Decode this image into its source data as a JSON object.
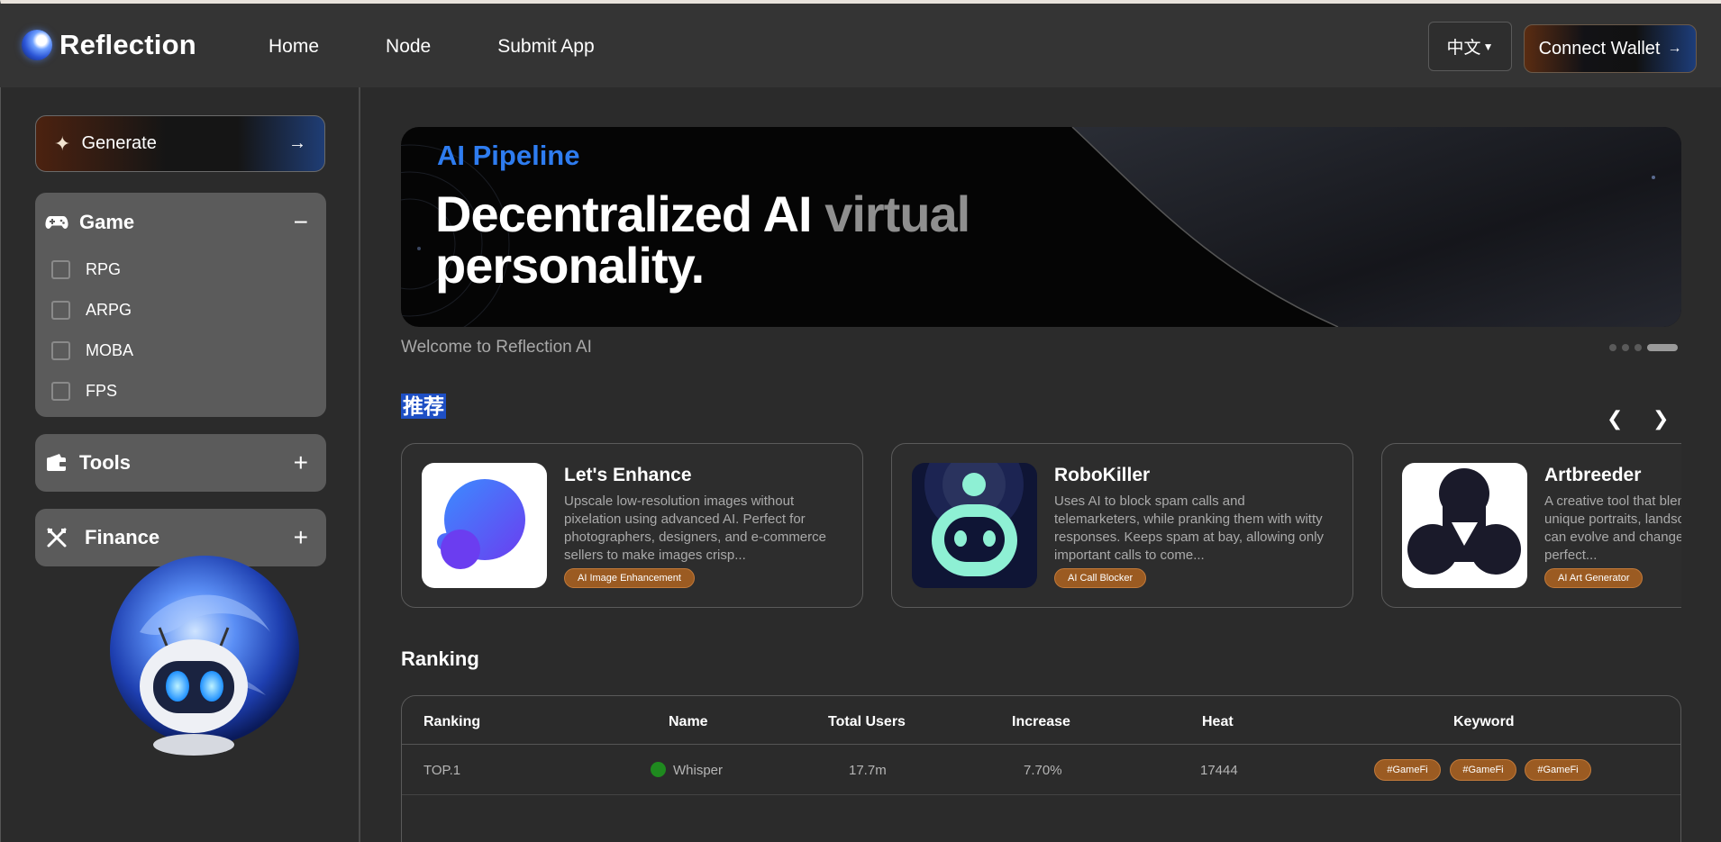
{
  "app": {
    "name": "Reflection"
  },
  "nav": {
    "items": [
      "Home",
      "Node",
      "Submit App"
    ],
    "language": "中文",
    "connect_wallet": "Connect Wallet"
  },
  "sidebar": {
    "generate_label": "Generate",
    "categories": [
      {
        "title": "Game",
        "expanded": true,
        "toggle": "−",
        "options": [
          "RPG",
          "ARPG",
          "MOBA",
          "FPS"
        ]
      },
      {
        "title": "Tools",
        "expanded": false,
        "toggle": "+"
      },
      {
        "title": "Finance",
        "expanded": false,
        "toggle": "+"
      }
    ]
  },
  "banner": {
    "eyebrow": "AI Pipeline",
    "title_part1": "Decentralized AI ",
    "title_part2": "virtual",
    "title_line2": "personality.",
    "caption": "Welcome to Reflection AI",
    "slides_total": 4,
    "active_slide": 4
  },
  "recommended": {
    "title": "推荐",
    "cards": [
      {
        "name": "Let's Enhance",
        "description": "Upscale low-resolution images without pixelation using advanced AI. Perfect for photographers, designers, and e-commerce sellers to make images crisp...",
        "tag": "AI Image Enhancement"
      },
      {
        "name": "RoboKiller",
        "description": "Uses AI to block spam calls and telemarketers, while pranking them with witty responses. Keeps spam at bay, allowing only important calls to come...",
        "tag": "AI Call Blocker"
      },
      {
        "name": "Artbreeder",
        "description": "A creative tool that blends images to create unique portraits, landscapes, and more. You can evolve and change visuals using AI, perfect...",
        "tag": "AI Art Generator"
      }
    ]
  },
  "ranking": {
    "title": "Ranking",
    "headers": [
      "Ranking",
      "Name",
      "Total Users",
      "Increase",
      "Heat",
      "Keyword"
    ],
    "rows": [
      {
        "rank": "TOP.1",
        "name": "Whisper",
        "total_users": "17.7m",
        "increase": "7.70%",
        "heat": "17444",
        "keywords": [
          "#GameFi",
          "#GameFi",
          "#GameFi"
        ]
      }
    ]
  },
  "colors": {
    "accent_blue": "#2e7cf0",
    "tag_orange": "#9b5b22",
    "status_green": "#1f8a1f"
  }
}
